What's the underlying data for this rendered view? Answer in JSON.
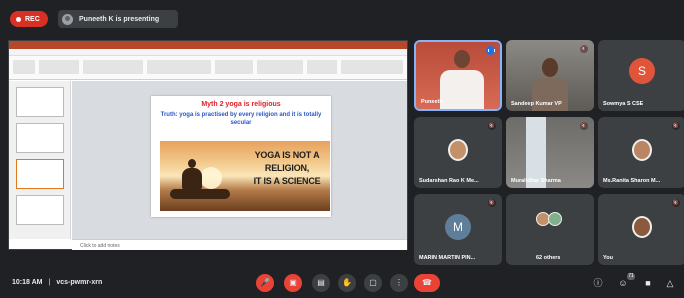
{
  "topbar": {
    "rec_label": "REC",
    "presenting_text": "Puneeth K is presenting"
  },
  "slide": {
    "myth": "Myth 2 yoga is religious",
    "truth": "Truth: yoga is practised by every religion and it is totally secular",
    "image_text_line1": "YOGA IS NOT A",
    "image_text_line2": "RELIGION,",
    "image_text_line3": "IT IS A SCIENCE"
  },
  "ppt": {
    "notes_placeholder": "Click to add notes"
  },
  "participants": [
    {
      "name": "Puneeth",
      "state": "speaking"
    },
    {
      "name": "Sandeep Kumar VP",
      "state": "muted"
    },
    {
      "name": "Sowmya S CSE",
      "initial": "S",
      "color": "#e0553a"
    },
    {
      "name": "Sudarshan Rao K Me...",
      "state": "muted"
    },
    {
      "name": "Muralidhar Sharma",
      "state": "muted"
    },
    {
      "name": "Ms.Ranita Sharon M...",
      "state": "muted"
    },
    {
      "name": "MARIN MARTIN PIN...",
      "initial": "M",
      "color": "#5f7e99"
    },
    {
      "name": "62 others"
    },
    {
      "name": "You",
      "state": "muted"
    }
  ],
  "bottombar": {
    "time": "10:18 AM",
    "separator": "|",
    "meeting_code": "vcs-pwmr-xrn",
    "people_count": "71"
  },
  "icons": {
    "mic_off": "mic-off-icon",
    "camera_off": "camera-off-icon",
    "captions": "captions-icon",
    "raise_hand": "hand-icon",
    "present": "present-icon",
    "more": "more-vert-icon",
    "end_call": "end-call-icon",
    "info": "info-icon",
    "people": "people-icon",
    "chat": "chat-icon",
    "activities": "activities-icon"
  },
  "colors": {
    "background": "#202124",
    "tile": "#3c4043",
    "red": "#ea4335",
    "accent": "#8ab4f8"
  }
}
